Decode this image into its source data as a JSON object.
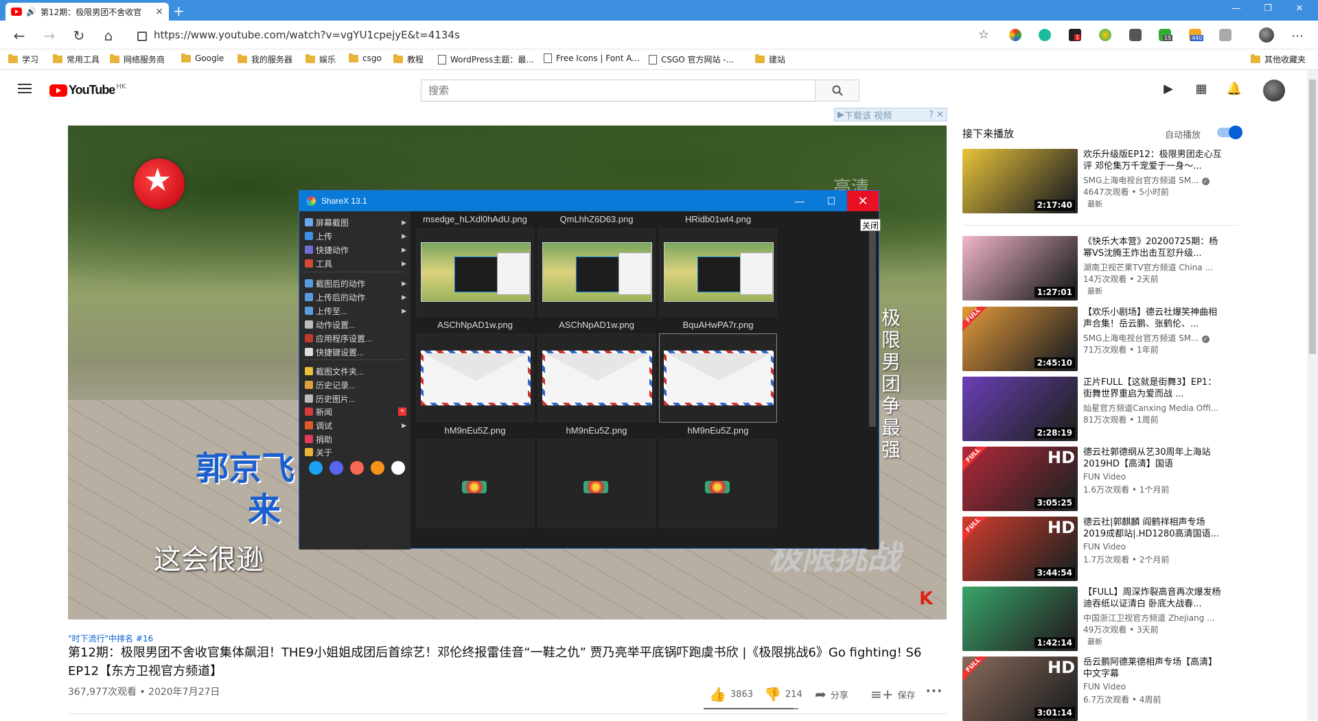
{
  "browser": {
    "tab_title": "第12期：极限男团不舍收官",
    "url": "https://www.youtube.com/watch?v=vgYU1cpejyE&t=4134s",
    "bookmarks": [
      {
        "label": "学习",
        "type": "folder"
      },
      {
        "label": "常用工具",
        "type": "folder"
      },
      {
        "label": "网络服务商",
        "type": "folder"
      },
      {
        "label": "Google",
        "type": "folder"
      },
      {
        "label": "我的服务器",
        "type": "folder"
      },
      {
        "label": "娱乐",
        "type": "folder"
      },
      {
        "label": "csgo",
        "type": "folder"
      },
      {
        "label": "教程",
        "type": "folder"
      },
      {
        "label": "WordPress主题：最...",
        "type": "page"
      },
      {
        "label": "Free Icons | Font A...",
        "type": "page"
      },
      {
        "label": "CSGO 官方网站 -...",
        "type": "page"
      },
      {
        "label": "建站",
        "type": "folder"
      }
    ],
    "other_bookmarks": "其他收藏夹",
    "ext_badges": {
      "b1": "1",
      "b2": "15",
      "b3": "440"
    }
  },
  "youtube": {
    "region": "HK",
    "logo_text": "YouTube",
    "search_placeholder": "搜索"
  },
  "video": {
    "download_bar": "下载该 视频",
    "sub_line1": "郭京飞",
    "sub_line2": "来",
    "sub_line3": "这会很逊",
    "vertical_text": "极限男团争最强",
    "watermark": "高清",
    "show_logo": "极限挑战",
    "corner_logo": "K"
  },
  "sharex": {
    "title": "ShareX 13.1",
    "close_tooltip": "关闭",
    "menu": [
      {
        "label": "屏幕截图",
        "arrow": true,
        "color": "#6aa7e8"
      },
      {
        "label": "上传",
        "arrow": true,
        "color": "#3b8fe5"
      },
      {
        "label": "快捷动作",
        "arrow": true,
        "color": "#6f6fd8"
      },
      {
        "label": "工具",
        "arrow": true,
        "color": "#d04a3a"
      },
      {
        "label": "截图后的动作",
        "arrow": true,
        "color": "#5a9be0"
      },
      {
        "label": "上传后的动作",
        "arrow": true,
        "color": "#5a9be0"
      },
      {
        "label": "上传至...",
        "arrow": true,
        "color": "#5a9be0"
      },
      {
        "label": "动作设置...",
        "arrow": false,
        "color": "#bbbbbb"
      },
      {
        "label": "应用程序设置...",
        "arrow": false,
        "color": "#c0392b"
      },
      {
        "label": "快捷键设置...",
        "arrow": false,
        "color": "#dddddd"
      },
      {
        "label": "截图文件夹...",
        "arrow": false,
        "color": "#e8c23a"
      },
      {
        "label": "历史记录...",
        "arrow": false,
        "color": "#e0a040"
      },
      {
        "label": "历史图片...",
        "arrow": false,
        "color": "#bbbbbb"
      },
      {
        "label": "新闻",
        "arrow": false,
        "color": "#d33c3c"
      },
      {
        "label": "调试",
        "arrow": true,
        "color": "#e05a2a"
      },
      {
        "label": "捐助",
        "arrow": false,
        "color": "#e33a5a"
      },
      {
        "label": "关于",
        "arrow": false,
        "color": "#e8b339"
      }
    ],
    "files": [
      {
        "name": "msedge_hLXdl0hAdU.png",
        "kind": "screenshot"
      },
      {
        "name": "QmLhhZ6D63.png",
        "kind": "screenshot"
      },
      {
        "name": "HRidb01wt4.png",
        "kind": "screenshot"
      },
      {
        "name": "ASChNpAD1w.png",
        "kind": "envelope"
      },
      {
        "name": "ASChNpAD1w.png",
        "kind": "envelope"
      },
      {
        "name": "BquAHwPA7r.png",
        "kind": "envelope"
      },
      {
        "name": "hM9nEu5Z.png",
        "kind": "flower"
      },
      {
        "name": "hM9nEu5Z.png",
        "kind": "flower"
      },
      {
        "name": "hM9nEu5Z.png",
        "kind": "flower"
      }
    ],
    "social_colors": [
      "#1da1f2",
      "#5865f2",
      "#f96854",
      "#f7931a",
      "#ffffff"
    ]
  },
  "watch": {
    "rank": "\"时下流行\"中排名 #16",
    "title": "第12期：极限男团不舍收官集体飙泪！THE9小姐姐成团后首综艺！邓伦终报雷佳音“一鞋之仇” 贾乃亮举平底锅吓跑虞书欣 |《极限挑战6》Go fighting! S6 EP12【东方卫视官方频道】",
    "meta": "367,977次观看 • 2020年7月27日",
    "likes": "3863",
    "dislikes": "214",
    "like_ratio": 0.947,
    "share": "分享",
    "save": "保存",
    "more": "•••"
  },
  "sidebar": {
    "up_next": "接下来播放",
    "autoplay": "自动播放",
    "autoplay_on": true,
    "items": [
      {
        "title": "欢乐升级版EP12：极限男团走心互评 邓伦集万千宠爱于一身～...",
        "channel": "SMG上海电视台官方频道 SM...",
        "verified": true,
        "views": "4647次观看 • 5小时前",
        "new": "最新",
        "duration": "2:17:40",
        "full": false,
        "hd": false,
        "thumb": "#e8c43a"
      },
      {
        "title": "《快乐大本营》20200725期：杨幂VS沈腾王炸出击互怼升级...",
        "channel": "湖南卫视芒果TV官方频道 China ...",
        "verified": false,
        "views": "14万次观看 • 2天前",
        "new": "最新",
        "duration": "1:27:01",
        "full": false,
        "hd": false,
        "thumb": "#f2b6c8"
      },
      {
        "title": "【欢乐小剧场】德云社爆笑神曲相声合集！岳云鹏、张鹤伦、...",
        "channel": "SMG上海电视台官方频道 SM...",
        "verified": true,
        "views": "71万次观看 • 1年前",
        "new": "",
        "duration": "2:45:10",
        "full": true,
        "hd": false,
        "thumb": "#e49a3a"
      },
      {
        "title": "正片FULL【这就是街舞3】EP1：街舞世界重启为爱而战 ...",
        "channel": "灿星官方频道Canxing Media Offi...",
        "verified": false,
        "views": "81万次观看 • 1周前",
        "new": "",
        "duration": "2:28:19",
        "full": false,
        "hd": false,
        "thumb": "#6a3fb8"
      },
      {
        "title": "德云社郭德纲从艺30周年上海站2019HD【高清】国语",
        "channel": "FUN Video",
        "verified": false,
        "views": "1.6万次观看 • 1个月前",
        "new": "",
        "duration": "3:05:25",
        "full": true,
        "hd": true,
        "thumb": "#b4283a"
      },
      {
        "title": "德云社|郭麒麟 阎鹤祥相声专场2019成都站|.HD1280高清国语...",
        "channel": "FUN Video",
        "verified": false,
        "views": "1.7万次观看 • 2个月前",
        "new": "",
        "duration": "3:44:54",
        "full": true,
        "hd": true,
        "thumb": "#d23c2c"
      },
      {
        "title": "【FULL】周深炸裂高音再次爆发杨迪吞纸以证清白 卧底大战春...",
        "channel": "中国浙江卫视官方频道 Zhejiang ...",
        "verified": false,
        "views": "49万次观看 • 3天前",
        "new": "最新",
        "duration": "1:42:14",
        "full": false,
        "hd": false,
        "thumb": "#3aa56a"
      },
      {
        "title": "岳云鹏阿德莱德相声专场【高清】中文字幕",
        "channel": "FUN Video",
        "verified": false,
        "views": "6.7万次观看 • 4周前",
        "new": "",
        "duration": "3:01:14",
        "full": true,
        "hd": true,
        "thumb": "#8a6a5a"
      }
    ]
  }
}
